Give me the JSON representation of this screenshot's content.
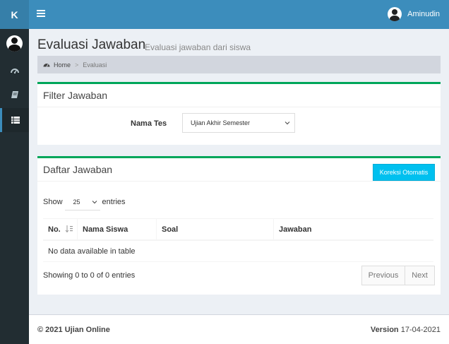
{
  "brand": {
    "logo_letter": "K"
  },
  "header": {
    "user_name": "Aminudin"
  },
  "sidebar": {
    "items": [
      {
        "icon": "dashboard-icon"
      },
      {
        "icon": "book-icon"
      },
      {
        "icon": "list-icon",
        "active": true
      }
    ]
  },
  "page": {
    "title": "Evaluasi Jawaban",
    "subtitle": "Evaluasi jawaban dari siswa"
  },
  "breadcrumb": {
    "home": "Home",
    "separator": ">",
    "current": "Evaluasi"
  },
  "filter": {
    "title": "Filter Jawaban",
    "label": "Nama Tes",
    "selected": "Ujian Akhir Semester"
  },
  "answers": {
    "title": "Daftar Jawaban",
    "auto_correct_button": "Koreksi Otomatis",
    "show_label": "Show",
    "entries_label": "entries",
    "page_length": "25",
    "columns": [
      "No.",
      "Nama Siswa",
      "Soal",
      "Jawaban"
    ],
    "empty_message": "No data available in table",
    "info": "Showing 0 to 0 of 0 entries",
    "pagination": {
      "previous": "Previous",
      "next": "Next"
    }
  },
  "footer": {
    "copyright": "© 2021 Ujian Online",
    "version_label": "Version",
    "version_value": "17-04-2021"
  },
  "colors": {
    "header": "#3c8dbc",
    "logo": "#367fa9",
    "sidebar": "#222d32",
    "box_border": "#00a65a",
    "info_button": "#00c0ef"
  }
}
